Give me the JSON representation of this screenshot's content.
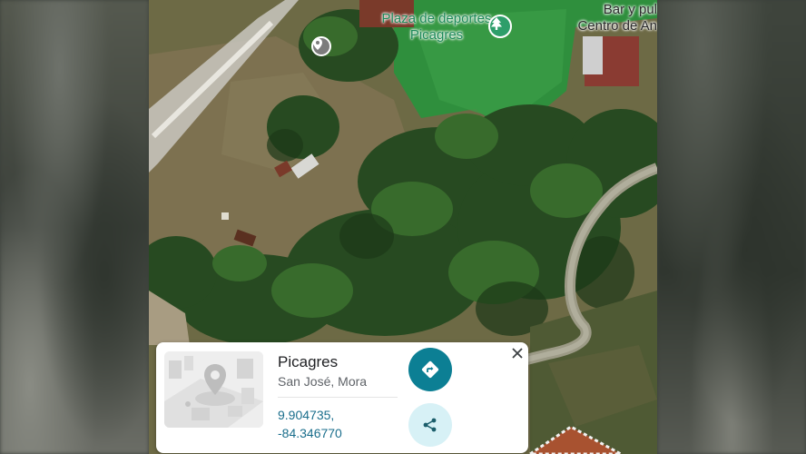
{
  "map": {
    "labels": {
      "plaza": "Plaza de deportes\nPicagres",
      "bar_line1": "Bar y pul",
      "bar_line2": "Centro de An"
    },
    "icons": {
      "plaza_pin": "tree-icon",
      "grey_pin": "location-pin-icon"
    }
  },
  "place_card": {
    "name": "Picagres",
    "address": "San José, Mora",
    "lat": "9.904735,",
    "lng": "-84.346770",
    "directions_icon": "directions-icon",
    "share_icon": "share-icon",
    "close_icon": "close-icon",
    "colors": {
      "directions_bg": "#0c7f94",
      "share_bg": "#d7f1f6",
      "coord_text": "#1a6e8c"
    }
  }
}
